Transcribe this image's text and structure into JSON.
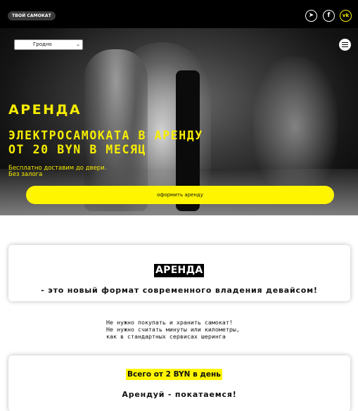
{
  "header": {
    "brand": "ТВОЙ САМОКАТ",
    "social": [
      {
        "name": "telegram",
        "glyph": "➤"
      },
      {
        "name": "facebook",
        "glyph": "f"
      },
      {
        "name": "vk",
        "glyph": "vk"
      }
    ],
    "accent_color": "#f7ed00"
  },
  "hero": {
    "city_select": {
      "value": "Гродно"
    },
    "title": "АРЕНДА",
    "subtitle_line1": "ЭЛЕКТРОСАМОКАТА В АРЕНДУ",
    "subtitle_line2": "ОТ 20 BYN В МЕСЯЦ",
    "note_line1": "Бесплатно доставим до двери.",
    "note_line2": "Без залога",
    "cta_label": "оформить аренду"
  },
  "about": {
    "badge": "АРЕНДА",
    "tagline": "- это новый формат современного владения девайсом!"
  },
  "benefits": {
    "line1": "Не нужно покупать и хранить самокат!",
    "line2": "Не нужно считать минуты или километры,",
    "line3": "как в стандартных сервисах шеринга"
  },
  "price": {
    "badge": "Всего от 2 BYN в день",
    "slogan": "Арендуй - покатаемся!"
  }
}
